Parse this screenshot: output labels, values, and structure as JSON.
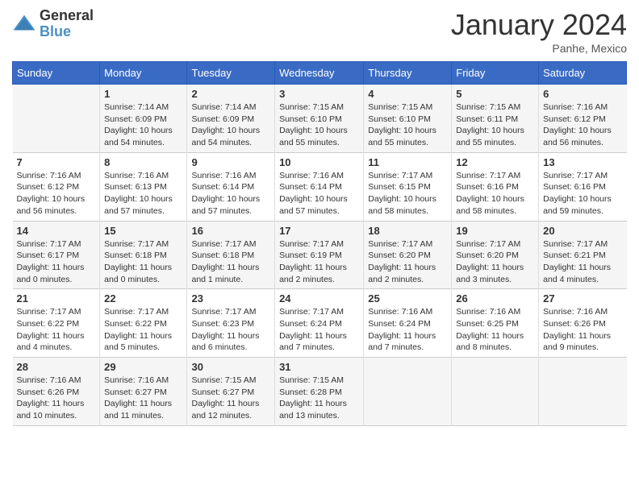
{
  "header": {
    "logo_general": "General",
    "logo_blue": "Blue",
    "month_title": "January 2024",
    "location": "Panhe, Mexico"
  },
  "days_of_week": [
    "Sunday",
    "Monday",
    "Tuesday",
    "Wednesday",
    "Thursday",
    "Friday",
    "Saturday"
  ],
  "weeks": [
    [
      {
        "day": "",
        "info": ""
      },
      {
        "day": "1",
        "info": "Sunrise: 7:14 AM\nSunset: 6:09 PM\nDaylight: 10 hours\nand 54 minutes."
      },
      {
        "day": "2",
        "info": "Sunrise: 7:14 AM\nSunset: 6:09 PM\nDaylight: 10 hours\nand 54 minutes."
      },
      {
        "day": "3",
        "info": "Sunrise: 7:15 AM\nSunset: 6:10 PM\nDaylight: 10 hours\nand 55 minutes."
      },
      {
        "day": "4",
        "info": "Sunrise: 7:15 AM\nSunset: 6:10 PM\nDaylight: 10 hours\nand 55 minutes."
      },
      {
        "day": "5",
        "info": "Sunrise: 7:15 AM\nSunset: 6:11 PM\nDaylight: 10 hours\nand 55 minutes."
      },
      {
        "day": "6",
        "info": "Sunrise: 7:16 AM\nSunset: 6:12 PM\nDaylight: 10 hours\nand 56 minutes."
      }
    ],
    [
      {
        "day": "7",
        "info": "Sunrise: 7:16 AM\nSunset: 6:12 PM\nDaylight: 10 hours\nand 56 minutes."
      },
      {
        "day": "8",
        "info": "Sunrise: 7:16 AM\nSunset: 6:13 PM\nDaylight: 10 hours\nand 57 minutes."
      },
      {
        "day": "9",
        "info": "Sunrise: 7:16 AM\nSunset: 6:14 PM\nDaylight: 10 hours\nand 57 minutes."
      },
      {
        "day": "10",
        "info": "Sunrise: 7:16 AM\nSunset: 6:14 PM\nDaylight: 10 hours\nand 57 minutes."
      },
      {
        "day": "11",
        "info": "Sunrise: 7:17 AM\nSunset: 6:15 PM\nDaylight: 10 hours\nand 58 minutes."
      },
      {
        "day": "12",
        "info": "Sunrise: 7:17 AM\nSunset: 6:16 PM\nDaylight: 10 hours\nand 58 minutes."
      },
      {
        "day": "13",
        "info": "Sunrise: 7:17 AM\nSunset: 6:16 PM\nDaylight: 10 hours\nand 59 minutes."
      }
    ],
    [
      {
        "day": "14",
        "info": "Sunrise: 7:17 AM\nSunset: 6:17 PM\nDaylight: 11 hours\nand 0 minutes."
      },
      {
        "day": "15",
        "info": "Sunrise: 7:17 AM\nSunset: 6:18 PM\nDaylight: 11 hours\nand 0 minutes."
      },
      {
        "day": "16",
        "info": "Sunrise: 7:17 AM\nSunset: 6:18 PM\nDaylight: 11 hours\nand 1 minute."
      },
      {
        "day": "17",
        "info": "Sunrise: 7:17 AM\nSunset: 6:19 PM\nDaylight: 11 hours\nand 2 minutes."
      },
      {
        "day": "18",
        "info": "Sunrise: 7:17 AM\nSunset: 6:20 PM\nDaylight: 11 hours\nand 2 minutes."
      },
      {
        "day": "19",
        "info": "Sunrise: 7:17 AM\nSunset: 6:20 PM\nDaylight: 11 hours\nand 3 minutes."
      },
      {
        "day": "20",
        "info": "Sunrise: 7:17 AM\nSunset: 6:21 PM\nDaylight: 11 hours\nand 4 minutes."
      }
    ],
    [
      {
        "day": "21",
        "info": "Sunrise: 7:17 AM\nSunset: 6:22 PM\nDaylight: 11 hours\nand 4 minutes."
      },
      {
        "day": "22",
        "info": "Sunrise: 7:17 AM\nSunset: 6:22 PM\nDaylight: 11 hours\nand 5 minutes."
      },
      {
        "day": "23",
        "info": "Sunrise: 7:17 AM\nSunset: 6:23 PM\nDaylight: 11 hours\nand 6 minutes."
      },
      {
        "day": "24",
        "info": "Sunrise: 7:17 AM\nSunset: 6:24 PM\nDaylight: 11 hours\nand 7 minutes."
      },
      {
        "day": "25",
        "info": "Sunrise: 7:16 AM\nSunset: 6:24 PM\nDaylight: 11 hours\nand 7 minutes."
      },
      {
        "day": "26",
        "info": "Sunrise: 7:16 AM\nSunset: 6:25 PM\nDaylight: 11 hours\nand 8 minutes."
      },
      {
        "day": "27",
        "info": "Sunrise: 7:16 AM\nSunset: 6:26 PM\nDaylight: 11 hours\nand 9 minutes."
      }
    ],
    [
      {
        "day": "28",
        "info": "Sunrise: 7:16 AM\nSunset: 6:26 PM\nDaylight: 11 hours\nand 10 minutes."
      },
      {
        "day": "29",
        "info": "Sunrise: 7:16 AM\nSunset: 6:27 PM\nDaylight: 11 hours\nand 11 minutes."
      },
      {
        "day": "30",
        "info": "Sunrise: 7:15 AM\nSunset: 6:27 PM\nDaylight: 11 hours\nand 12 minutes."
      },
      {
        "day": "31",
        "info": "Sunrise: 7:15 AM\nSunset: 6:28 PM\nDaylight: 11 hours\nand 13 minutes."
      },
      {
        "day": "",
        "info": ""
      },
      {
        "day": "",
        "info": ""
      },
      {
        "day": "",
        "info": ""
      }
    ]
  ]
}
